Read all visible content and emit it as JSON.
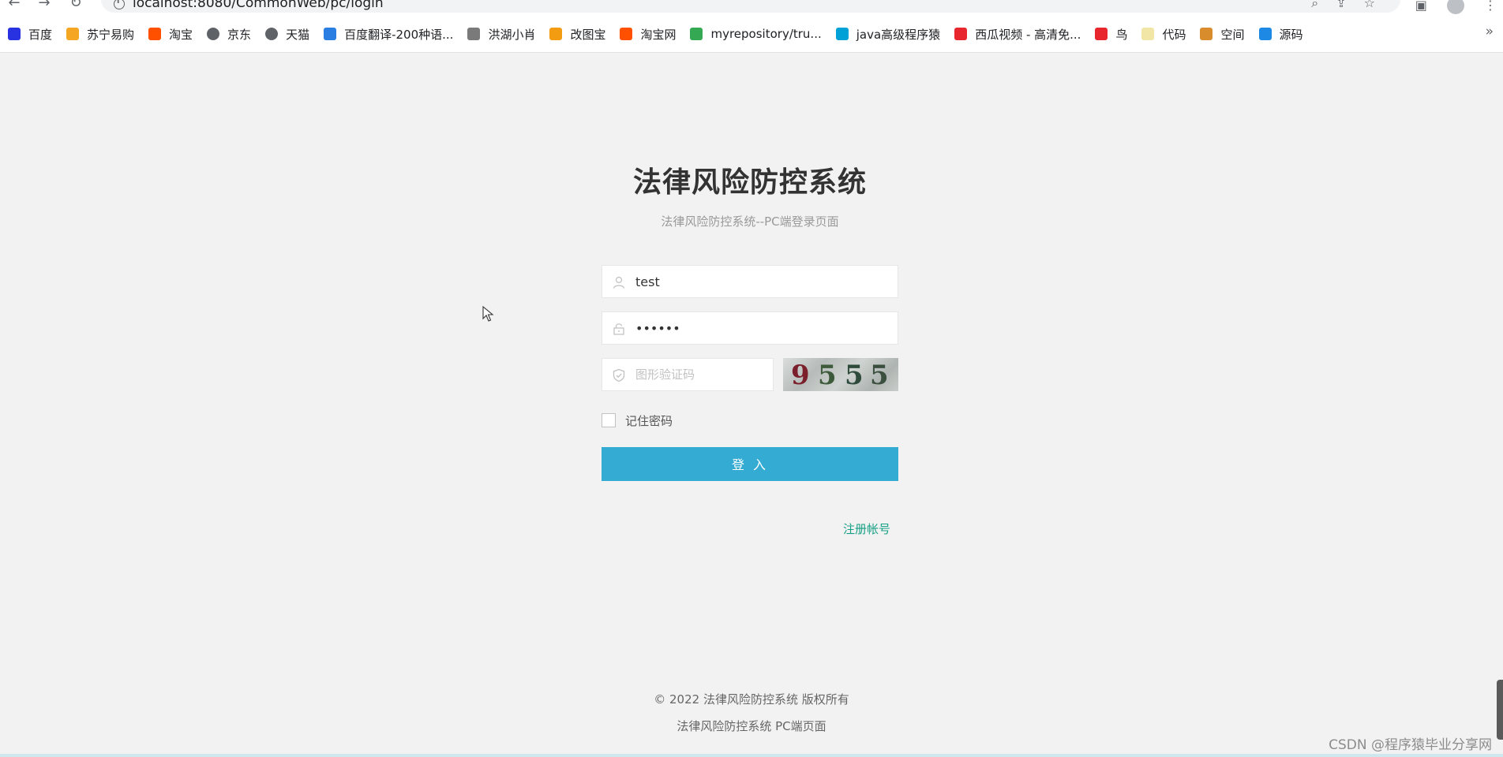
{
  "browser": {
    "url": "localhost:8080/CommonWeb/pc/login",
    "bookmarks": [
      {
        "label": "百度",
        "icon": "baidu-icon",
        "color": "#2932e1"
      },
      {
        "label": "苏宁易购",
        "icon": "suning-icon",
        "color": "#f5a623"
      },
      {
        "label": "淘宝",
        "icon": "taobao-icon",
        "color": "#ff5000"
      },
      {
        "label": "京东",
        "icon": "globe-icon",
        "color": "#5f6368"
      },
      {
        "label": "天猫",
        "icon": "globe-icon",
        "color": "#5f6368"
      },
      {
        "label": "百度翻译-200种语...",
        "icon": "translate-icon",
        "color": "#2a7de1"
      },
      {
        "label": "洪湖小肖",
        "icon": "bird-icon",
        "color": "#7a7a7a"
      },
      {
        "label": "改图宝",
        "icon": "gaitubao-icon",
        "color": "#f39c12"
      },
      {
        "label": "淘宝网",
        "icon": "taobao-icon",
        "color": "#ff5000"
      },
      {
        "label": "myrepository/tru...",
        "icon": "chrome-icon",
        "color": "#34a853"
      },
      {
        "label": "java高级程序猿",
        "icon": "bilibili-icon",
        "color": "#00a1d6"
      },
      {
        "label": "西瓜视频 - 高清免...",
        "icon": "xigua-icon",
        "color": "#e8262d"
      },
      {
        "label": "鸟",
        "icon": "bird-red-icon",
        "color": "#e8262d"
      },
      {
        "label": "代码",
        "icon": "code-icon",
        "color": "#f1e6a6"
      },
      {
        "label": "空间",
        "icon": "qzone-icon",
        "color": "#d98c2b"
      },
      {
        "label": "源码",
        "icon": "fish-icon",
        "color": "#1e88e5"
      }
    ],
    "more": "»"
  },
  "login": {
    "title": "法律风险防控系统",
    "subtitle": "法律风险防控系统--PC端登录页面",
    "username_value": "test",
    "password_value": "••••••",
    "captcha_placeholder": "图形验证码",
    "captcha_digits": [
      "9",
      "5",
      "5",
      "5"
    ],
    "remember_label": "记住密码",
    "login_button": "登 入",
    "register_link": "注册帐号",
    "accent_color": "#33abd3",
    "link_color": "#16a085"
  },
  "footer": {
    "copyright": "© 2022 法律风险防控系统 版权所有",
    "page_name": "法律风险防控系统 PC端页面"
  },
  "watermark": "CSDN @程序猿毕业分享网"
}
